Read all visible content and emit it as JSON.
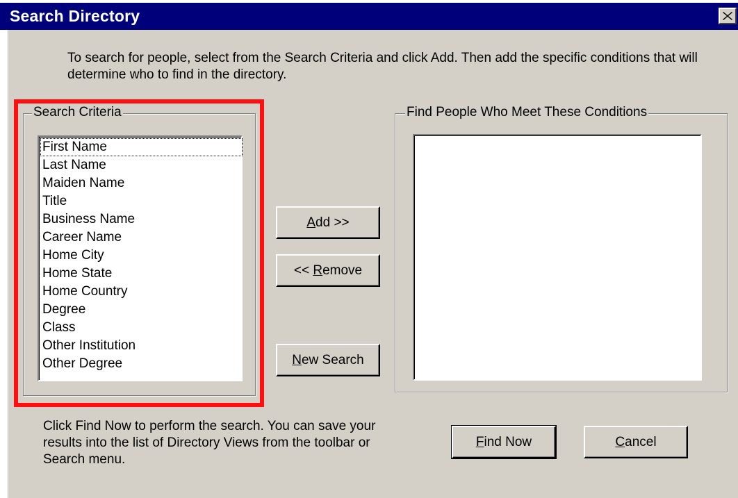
{
  "window": {
    "title": "Search Directory",
    "close_glyph": "✕"
  },
  "intro_text": "To search for people, select from the Search Criteria and click Add. Then add the specific conditions that will determine who to find in the directory.",
  "search_criteria": {
    "label": "Search Criteria",
    "items": [
      "First Name",
      "Last Name",
      "Maiden Name",
      "Title",
      "Business Name",
      "Career Name",
      "Home City",
      "Home State",
      "Home Country",
      "Degree",
      "Class",
      "Other Institution",
      "Other Degree"
    ],
    "focused_index": 0
  },
  "conditions": {
    "label": "Find People Who Meet These Conditions",
    "items": []
  },
  "buttons": {
    "add": {
      "mnemonic": "A",
      "rest": "dd >>"
    },
    "remove": {
      "prefix": "<< ",
      "mnemonic": "R",
      "rest": "emove"
    },
    "new_search": {
      "mnemonic": "N",
      "rest": "ew Search"
    },
    "find_now": {
      "mnemonic": "F",
      "rest": "ind Now"
    },
    "cancel": {
      "mnemonic": "C",
      "rest": "ancel"
    }
  },
  "footer_text": "Click Find Now to perform the search.  You can save your results into the list of Directory Views from the toolbar or Search menu.",
  "colors": {
    "titlebar": "#00007b",
    "dialog_bg": "#d4d0c8",
    "highlight_frame": "#ff1010"
  }
}
